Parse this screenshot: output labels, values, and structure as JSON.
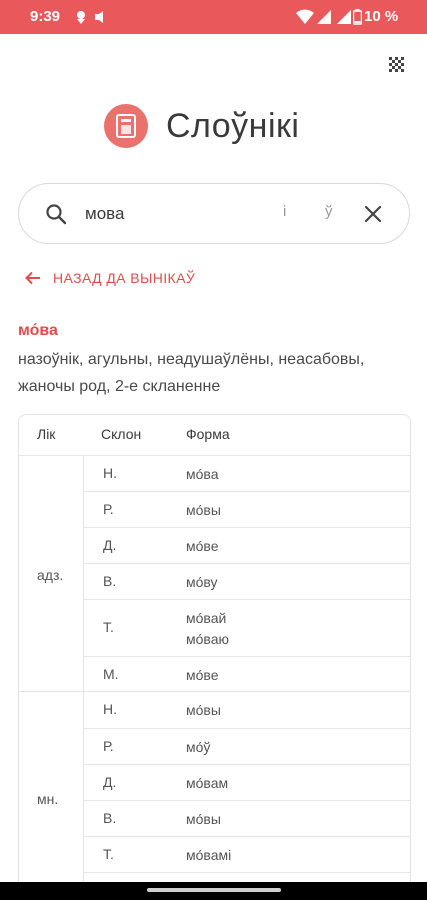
{
  "status": {
    "time": "9:39",
    "battery": "10 %"
  },
  "app": {
    "title": "Слоўнікі"
  },
  "search": {
    "value": "мова",
    "key_i": "і",
    "key_u": "ў"
  },
  "back": {
    "label": "НАЗАД ДА ВЫНІКАЎ"
  },
  "word": {
    "head": "мо́ва",
    "description": "назоўнік, агульны, неадушаўлёны, неасабовы, жаночы род, 2-е скланенне"
  },
  "table": {
    "headers": {
      "number": "Лік",
      "case": "Склон",
      "form": "Форма"
    },
    "groups": [
      {
        "label": "адз.",
        "rows": [
          {
            "case": "Н.",
            "forms": [
              "мо́ва"
            ]
          },
          {
            "case": "Р.",
            "forms": [
              "мо́вы"
            ]
          },
          {
            "case": "Д.",
            "forms": [
              "мо́ве"
            ]
          },
          {
            "case": "В.",
            "forms": [
              "мо́ву"
            ]
          },
          {
            "case": "Т.",
            "forms": [
              "мо́вай",
              "мо́ваю"
            ]
          },
          {
            "case": "М.",
            "forms": [
              "мо́ве"
            ]
          }
        ]
      },
      {
        "label": "мн.",
        "rows": [
          {
            "case": "Н.",
            "forms": [
              "мо́вы"
            ]
          },
          {
            "case": "Р.",
            "forms": [
              "мо́ў"
            ]
          },
          {
            "case": "Д.",
            "forms": [
              "мо́вам"
            ]
          },
          {
            "case": "В.",
            "forms": [
              "мо́вы"
            ]
          },
          {
            "case": "Т.",
            "forms": [
              "мо́вамі"
            ]
          }
        ]
      }
    ]
  },
  "colors": {
    "accent": "#e9585b",
    "link": "#e14d4d"
  },
  "icons": [
    "gps-icon",
    "notification-icon",
    "wifi-icon",
    "signal-icon",
    "battery-icon",
    "grid-menu-icon",
    "dictionary-logo-icon",
    "search-icon",
    "close-icon",
    "arrow-left-icon"
  ]
}
